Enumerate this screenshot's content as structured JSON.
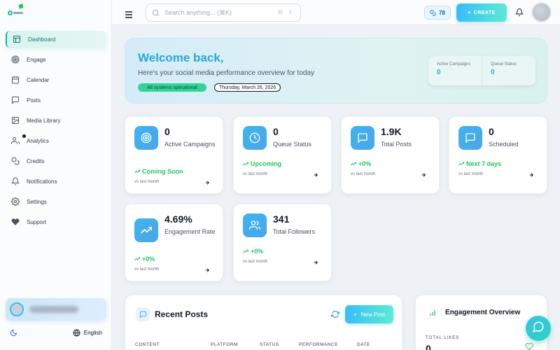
{
  "colors": {
    "accent": "#2ba6d9",
    "teal": "#14b8a6",
    "success": "#22c55e",
    "card_icon": "#3fb4ee"
  },
  "sidebar": {
    "items": [
      {
        "label": "Dashboard",
        "icon": "layout-icon",
        "active": true
      },
      {
        "label": "Engage",
        "icon": "target-icon"
      },
      {
        "label": "Calendar",
        "icon": "calendar-icon"
      },
      {
        "label": "Posts",
        "icon": "message-square-icon"
      },
      {
        "label": "Media Library",
        "icon": "image-icon"
      },
      {
        "label": "Analytics",
        "icon": "users-icon"
      },
      {
        "label": "Credits",
        "icon": "coins-icon"
      },
      {
        "label": "Notifications",
        "icon": "bell-icon"
      },
      {
        "label": "Settings",
        "icon": "gear-icon"
      },
      {
        "label": "Support",
        "icon": "heart-icon"
      }
    ],
    "language": "English"
  },
  "header": {
    "search_placeholder": "Search anything... (⌘K)",
    "shortcut": "⌘ K",
    "credits": "78",
    "create_label": "CREATE"
  },
  "welcome": {
    "title": "Welcome back,",
    "subtitle": "Here's your social media performance overview for today",
    "status": "All systems operational",
    "date": "Thursday, March 26, 2026",
    "mini_stats": [
      {
        "label": "Active Campaigns",
        "value": "0"
      },
      {
        "label": "Queue Status",
        "value": "0"
      }
    ]
  },
  "stats": [
    {
      "value": "0",
      "label": "Active Campaigns",
      "trend": "Coming Soon",
      "vs": "vs last month",
      "icon": "target-icon"
    },
    {
      "value": "0",
      "label": "Queue Status",
      "trend": "Upcoming",
      "vs": "vs last month",
      "icon": "clock-icon"
    },
    {
      "value": "1.9K",
      "label": "Total Posts",
      "trend": "+0%",
      "vs": "vs last month",
      "icon": "message-square-icon"
    },
    {
      "value": "0",
      "label": "Scheduled",
      "trend": "Next 7 days",
      "vs": "vs last month",
      "icon": "message-square-icon"
    },
    {
      "value": "4.69%",
      "label": "Engagement Rate",
      "trend": "+0%",
      "vs": "vs last month",
      "icon": "trending-up-icon"
    },
    {
      "value": "341",
      "label": "Total Followers",
      "trend": "+0%",
      "vs": "vs last month",
      "icon": "users-icon"
    }
  ],
  "recent_posts": {
    "title": "Recent Posts",
    "new_post_label": "New Post",
    "columns": [
      "CONTENT",
      "PLATFORM",
      "STATUS",
      "PERFORMANCE",
      "DATE"
    ]
  },
  "engagement": {
    "title": "Engagement Overview",
    "total_likes_label": "TOTAL LIKES",
    "total_likes_value": "0"
  }
}
